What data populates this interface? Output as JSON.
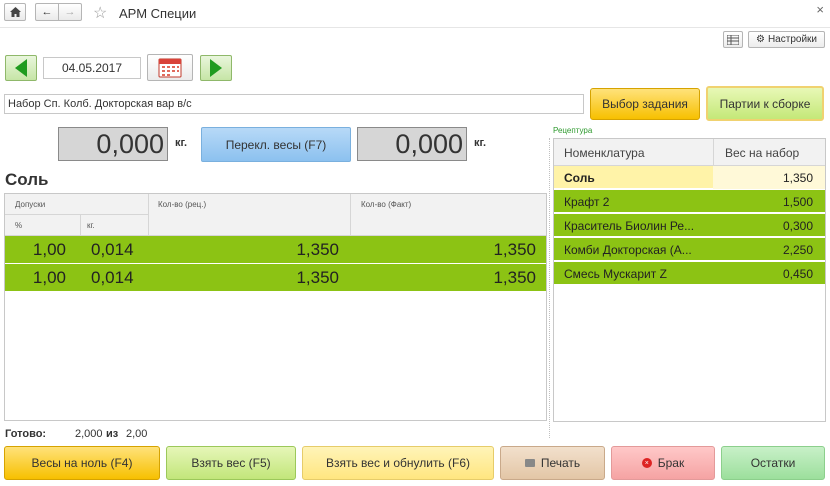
{
  "window": {
    "title": "АРМ Специи"
  },
  "toolbar": {
    "settings_label": "Настройки"
  },
  "date_nav": {
    "date": "04.05.2017"
  },
  "task": {
    "value": "Набор Сп. Колб. Докторская вар в/с",
    "select_task_label": "Выбор задания",
    "batches_label": "Партии к сборке"
  },
  "scales": {
    "scale1_value": "0,000",
    "scale2_value": "0,000",
    "unit": "кг.",
    "switch_label": "Перекл. весы (F7)"
  },
  "ingredient": {
    "name": "Соль"
  },
  "left_table": {
    "header_tolerance": "Допуски",
    "header_percent": "%",
    "header_kg": "кг.",
    "header_qty_recipe": "Кол-во (рец.)",
    "header_qty_fact": "Кол-во (Факт)",
    "rows": [
      {
        "percent": "1,00",
        "kg": "0,014",
        "recipe": "1,350",
        "fact": "1,350"
      },
      {
        "percent": "1,00",
        "kg": "0,014",
        "recipe": "1,350",
        "fact": "1,350"
      }
    ]
  },
  "recipe": {
    "label": "Рецептура",
    "header_name": "Номенклатура",
    "header_weight": "Вес на набор",
    "rows": [
      {
        "name": "Соль",
        "weight": "1,350"
      },
      {
        "name": "Крафт 2",
        "weight": "1,500"
      },
      {
        "name": "Краситель Биолин Ре...",
        "weight": "0,300"
      },
      {
        "name": "Комби Докторская (А...",
        "weight": "2,250"
      },
      {
        "name": "Смесь Мускарит Z",
        "weight": "0,450"
      }
    ]
  },
  "status": {
    "ready_label": "Готово:",
    "done": "2,000",
    "of": "из",
    "total": "2,00"
  },
  "buttons": {
    "zero": "Весы на ноль (F4)",
    "take": "Взять вес (F5)",
    "take_reset": "Взять вес и обнулить (F6)",
    "print": "Печать",
    "reject": "Брак",
    "remains": "Остатки"
  },
  "colors": {
    "accent_yellow": "#f7c000",
    "row_green": "#8cc314",
    "active_row": "#fff3a8"
  }
}
